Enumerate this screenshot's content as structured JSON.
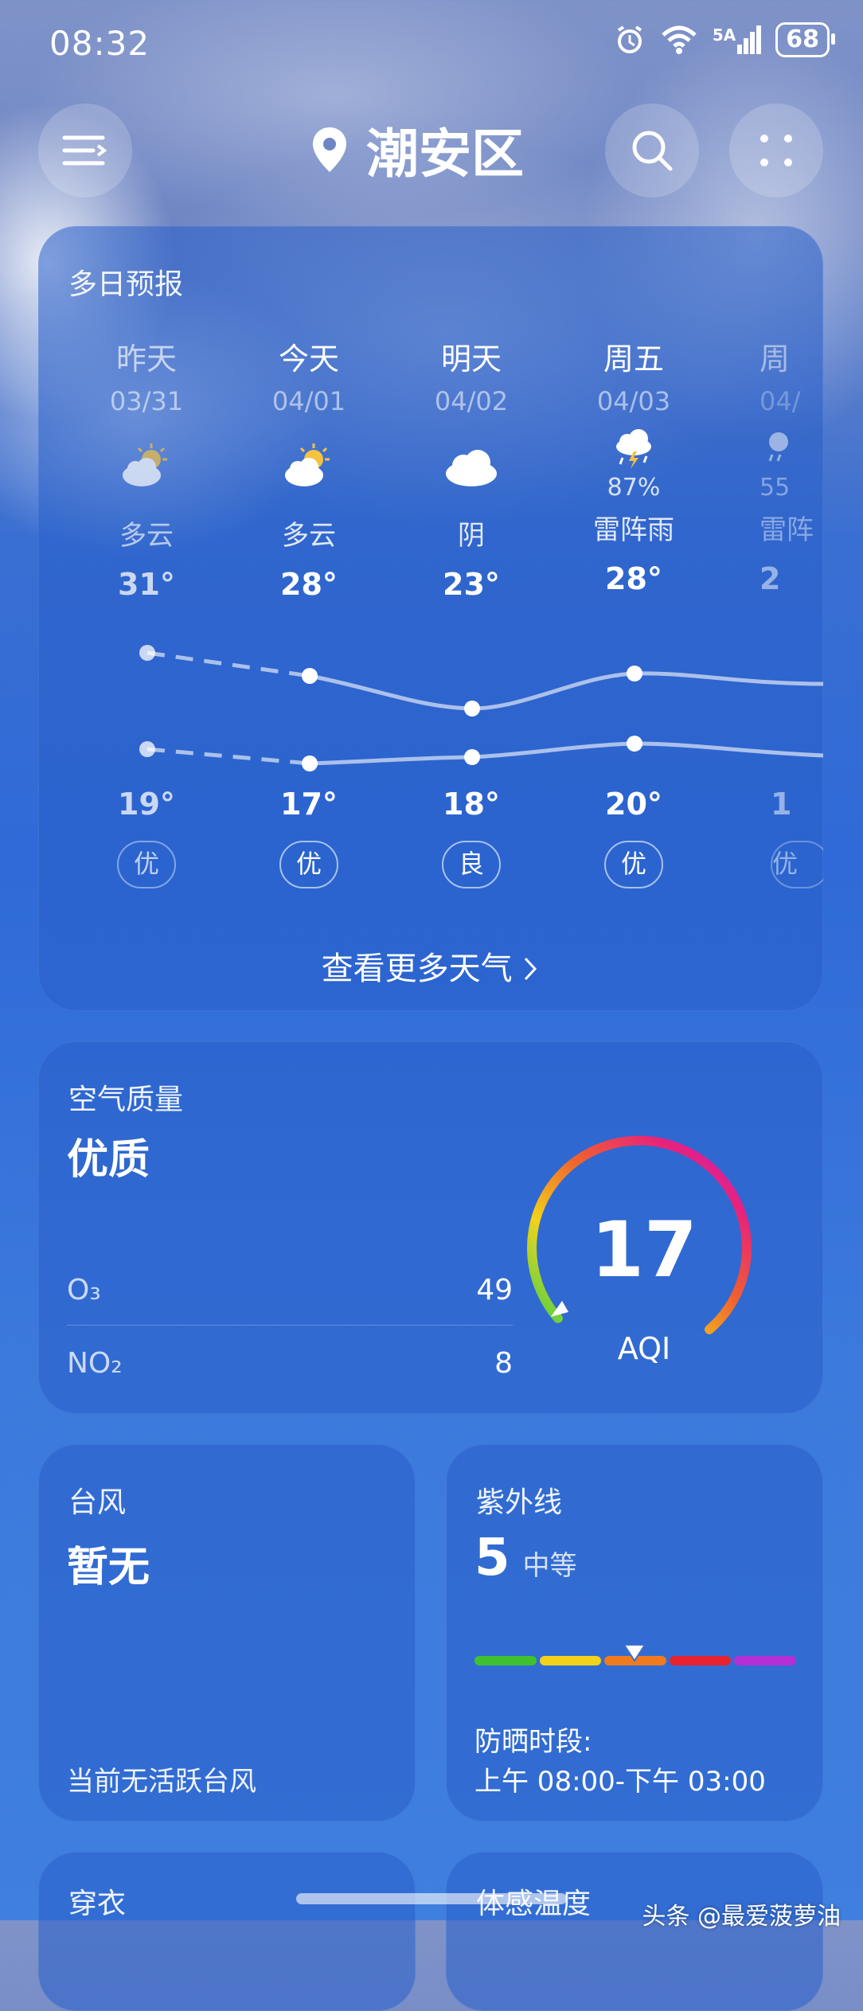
{
  "status_bar": {
    "time": "08:32",
    "network": "5A",
    "battery": "68"
  },
  "header": {
    "location": "潮安区"
  },
  "forecast": {
    "title": "多日预报",
    "days": [
      {
        "day": "昨天",
        "date": "03/31",
        "desc": "多云",
        "high": "31°",
        "low": "19°",
        "aqi": "优",
        "icon": "partly-cloudy-icon"
      },
      {
        "day": "今天",
        "date": "04/01",
        "desc": "多云",
        "high": "28°",
        "low": "17°",
        "aqi": "优",
        "icon": "partly-cloudy-icon"
      },
      {
        "day": "明天",
        "date": "04/02",
        "desc": "阴",
        "high": "23°",
        "low": "18°",
        "aqi": "良",
        "icon": "cloud-icon"
      },
      {
        "day": "周五",
        "date": "04/03",
        "desc": "雷阵雨",
        "high": "28°",
        "low": "20°",
        "aqi": "优",
        "icon": "thunderstorm-icon",
        "prob": "87%"
      },
      {
        "day": "周",
        "date": "04/",
        "desc": "雷阵",
        "high": "2",
        "low": "1",
        "aqi": "优",
        "icon": "rain-icon",
        "prob": "55"
      }
    ],
    "more_label": "查看更多天气"
  },
  "air_quality": {
    "title": "空气质量",
    "level": "优质",
    "o3_label": "O₃",
    "o3_value": "49",
    "no2_label": "NO₂",
    "no2_value": "8",
    "aqi_value": "17",
    "aqi_label": "AQI"
  },
  "typhoon": {
    "title": "台风",
    "status": "暂无",
    "note": "当前无活跃台风"
  },
  "uv": {
    "title": "紫外线",
    "value": "5",
    "level": "中等",
    "period_label": "防晒时段:",
    "period": "上午 08:00-下午 03:00",
    "colors": [
      "#3fc12f",
      "#f2d21a",
      "#f07a1e",
      "#e8222e",
      "#b42fd6"
    ]
  },
  "bottom_cards": {
    "left_title": "穿衣",
    "right_title": "体感温度"
  },
  "watermark": "头条 @最爱菠萝油"
}
